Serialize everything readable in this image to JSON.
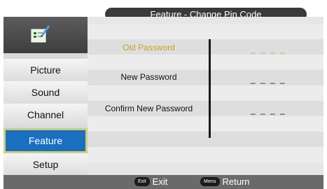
{
  "title": "Feature - Change Pin Code",
  "sidebar": {
    "logo_icon": "notepad-pencil-icon",
    "items": [
      {
        "label": "Picture",
        "active": false
      },
      {
        "label": "Sound",
        "active": false
      },
      {
        "label": "Channel",
        "active": false
      },
      {
        "label": "Feature",
        "active": true
      },
      {
        "label": "Setup",
        "active": false
      }
    ]
  },
  "fields": [
    {
      "label": "Old Password",
      "value": "_ _ _ _",
      "selected": true
    },
    {
      "label": "New Password",
      "value": "_ _ _ _",
      "selected": false
    },
    {
      "label": "Confirm New Password",
      "value": "_ _ _ _",
      "selected": false
    }
  ],
  "footer": {
    "exit_key": "Exit",
    "exit_label": "Exit",
    "return_key": "Menu",
    "return_label": "Return"
  },
  "colors": {
    "selected_text": "#c9a227",
    "active_tab": "#1a6fc0",
    "active_border": "#cfcf7a"
  }
}
